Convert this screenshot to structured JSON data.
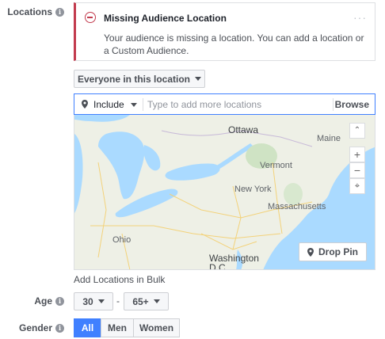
{
  "locations": {
    "label": "Locations",
    "alert": {
      "title": "Missing Audience Location",
      "body": "Your audience is missing a location. You can add a location or a Custom Audience.",
      "more": "···"
    },
    "scope_dropdown": "Everyone in this location",
    "include_dropdown": "Include",
    "search_placeholder": "Type to add more locations",
    "browse_label": "Browse",
    "map": {
      "labels": [
        "Ottawa",
        "Maine",
        "Vermont",
        "New York",
        "Massachusetts",
        "Ohio",
        "Washington",
        "D.C."
      ],
      "zoom_in": "+",
      "zoom_out": "−",
      "drop_pin_label": "Drop Pin"
    },
    "bulk_link": "Add Locations in Bulk"
  },
  "age": {
    "label": "Age",
    "min": "30",
    "separator": "-",
    "max": "65+"
  },
  "gender": {
    "label": "Gender",
    "options": [
      "All",
      "Men",
      "Women"
    ],
    "selected": "All"
  },
  "colors": {
    "alert_accent": "#c23b4e",
    "primary": "#4080ff",
    "water": "#aadaff",
    "land": "#eef0e6"
  }
}
